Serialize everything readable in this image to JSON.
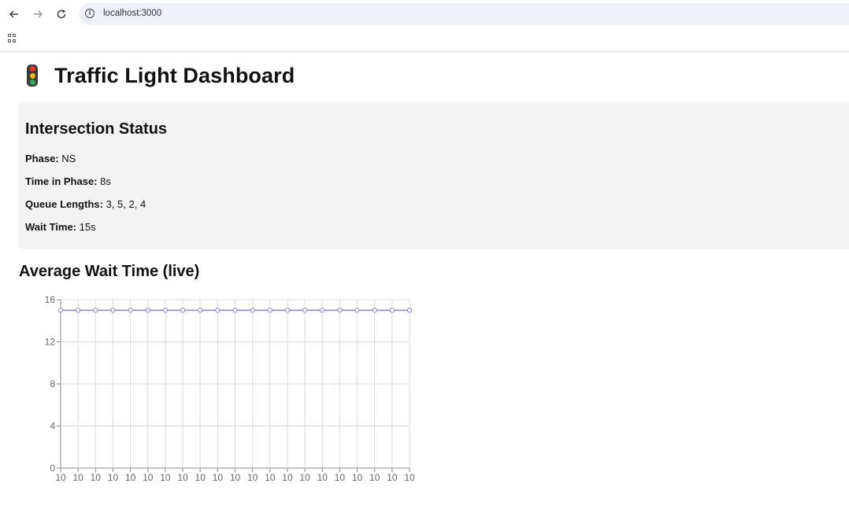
{
  "browser": {
    "url": "localhost:3000",
    "back_icon": "arrow-left-icon",
    "forward_icon": "arrow-right-icon",
    "reload_icon": "reload-icon",
    "site_info_icon": "info-icon",
    "apps_icon": "apps-grid-icon"
  },
  "page": {
    "icon": "traffic-light-icon",
    "title": "Traffic Light Dashboard"
  },
  "status": {
    "heading": "Intersection Status",
    "fields": [
      {
        "label": "Phase:",
        "value": "NS"
      },
      {
        "label": "Time in Phase:",
        "value": "8s"
      },
      {
        "label": "Queue Lengths:",
        "value": "3, 5, 2, 4"
      },
      {
        "label": "Wait Time:",
        "value": "15s"
      }
    ]
  },
  "chart_data": {
    "type": "line",
    "title": "Average Wait Time (live)",
    "categories": [
      "10",
      "10",
      "10",
      "10",
      "10",
      "10",
      "10",
      "10",
      "10",
      "10",
      "10",
      "10",
      "10",
      "10",
      "10",
      "10",
      "10",
      "10",
      "10",
      "10",
      "10"
    ],
    "series": [
      {
        "values": [
          15,
          15,
          15,
          15,
          15,
          15,
          15,
          15,
          15,
          15,
          15,
          15,
          15,
          15,
          15,
          15,
          15,
          15,
          15,
          15,
          15
        ]
      }
    ],
    "ylim": [
      0,
      16
    ],
    "yticks": [
      0,
      4,
      8,
      12,
      16
    ],
    "grid": true,
    "line_color": "#8884d8"
  }
}
